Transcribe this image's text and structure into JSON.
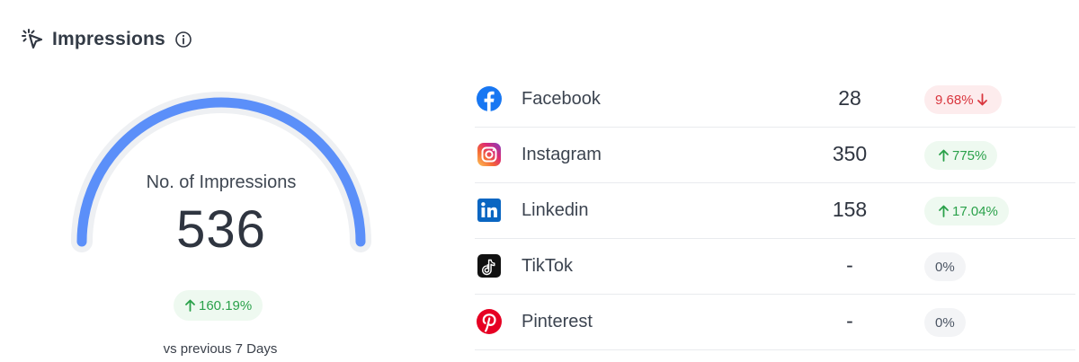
{
  "header": {
    "title": "Impressions",
    "title_icon": "click-cursor-icon",
    "info_icon": "info-icon"
  },
  "gauge": {
    "label": "No. of Impressions",
    "value": "536",
    "fill_fraction": 1.0,
    "color": "#5b8ff9",
    "track_color": "#eef0f3"
  },
  "summary": {
    "change": "160.19%",
    "direction": "up",
    "comparison": "vs previous 7 Days"
  },
  "platforms": [
    {
      "name": "Facebook",
      "icon": "facebook-icon",
      "count": "28",
      "change": "9.68%",
      "direction": "down"
    },
    {
      "name": "Instagram",
      "icon": "instagram-icon",
      "count": "350",
      "change": "775%",
      "direction": "up"
    },
    {
      "name": "Linkedin",
      "icon": "linkedin-icon",
      "count": "158",
      "change": "17.04%",
      "direction": "up"
    },
    {
      "name": "TikTok",
      "icon": "tiktok-icon",
      "count": "-",
      "change": "0%",
      "direction": "neutral"
    },
    {
      "name": "Pinterest",
      "icon": "pinterest-icon",
      "count": "-",
      "change": "0%",
      "direction": "neutral"
    }
  ],
  "colors": {
    "up": "#2aa14a",
    "down": "#d9363e",
    "facebook": "#1877f2",
    "linkedin": "#0a66c2",
    "pinterest": "#e60023",
    "tiktok": "#111111"
  }
}
